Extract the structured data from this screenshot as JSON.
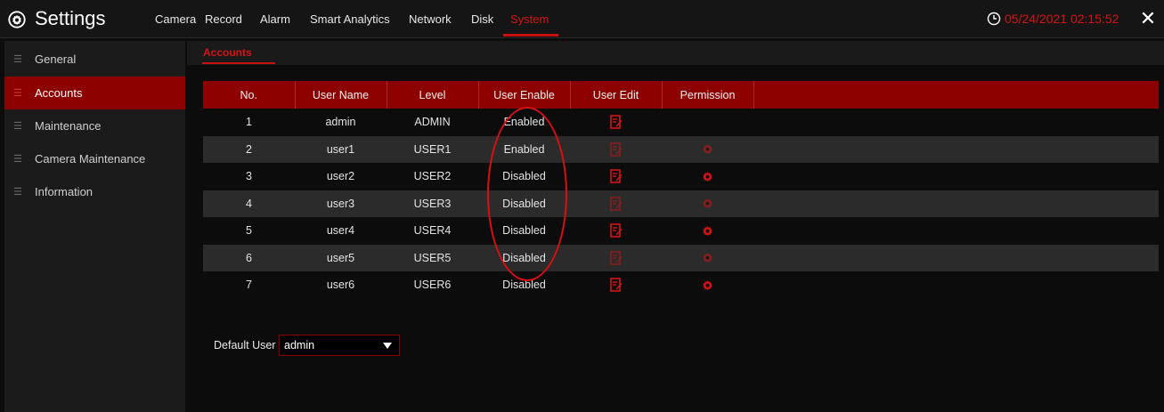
{
  "app": {
    "title": "Settings",
    "icon": "gear-icon"
  },
  "tabs": [
    {
      "label": "Camera"
    },
    {
      "label": "Record"
    },
    {
      "label": "Alarm"
    },
    {
      "label": "Smart Analytics"
    },
    {
      "label": "Network"
    },
    {
      "label": "Disk"
    },
    {
      "label": "System",
      "active": true
    }
  ],
  "clock": {
    "text": "05/24/2021 02:15:52",
    "icon": "clock-icon"
  },
  "close": {
    "label": "✕"
  },
  "sidebar": {
    "items": [
      {
        "label": "General"
      },
      {
        "label": "Accounts",
        "active": true
      },
      {
        "label": "Maintenance"
      },
      {
        "label": "Camera Maintenance"
      },
      {
        "label": "Information"
      }
    ]
  },
  "subtabs": [
    {
      "label": "Accounts",
      "active": true
    }
  ],
  "table": {
    "headers": [
      "No.",
      "User Name",
      "Level",
      "User Enable",
      "User Edit",
      "Permission",
      ""
    ],
    "rows": [
      {
        "no": "1",
        "user": "admin",
        "level": "ADMIN",
        "enable": "Enabled",
        "edit": true,
        "permission": false
      },
      {
        "no": "2",
        "user": "user1",
        "level": "USER1",
        "enable": "Enabled",
        "edit": true,
        "permission": true
      },
      {
        "no": "3",
        "user": "user2",
        "level": "USER2",
        "enable": "Disabled",
        "edit": true,
        "permission": true
      },
      {
        "no": "4",
        "user": "user3",
        "level": "USER3",
        "enable": "Disabled",
        "edit": true,
        "permission": true
      },
      {
        "no": "5",
        "user": "user4",
        "level": "USER4",
        "enable": "Disabled",
        "edit": true,
        "permission": true
      },
      {
        "no": "6",
        "user": "user5",
        "level": "USER5",
        "enable": "Disabled",
        "edit": true,
        "permission": true
      },
      {
        "no": "7",
        "user": "user6",
        "level": "USER6",
        "enable": "Disabled",
        "edit": true,
        "permission": true
      }
    ]
  },
  "default_user": {
    "label": "Default User",
    "value": "admin"
  },
  "colors": {
    "accent": "#d41414",
    "header_bg": "#8c0000",
    "row_alt": "#2b2b2b"
  }
}
